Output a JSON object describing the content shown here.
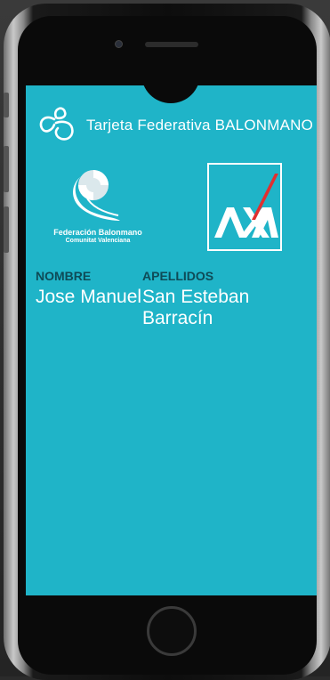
{
  "app": {
    "title": "Tarjeta Federativa BALONMANO",
    "logo_icon": "handball-swirl-icon"
  },
  "logos": {
    "federation": {
      "line1": "Federación Balonmano",
      "line2": "Comunitat Valenciana",
      "icon": "handball-ball-icon"
    },
    "sponsor": {
      "text": "AXA",
      "icon": "axa-logo-icon"
    }
  },
  "card": {
    "first_name_label": "NOMBRE",
    "first_name_value": "Jose Manuel",
    "last_name_label": "APELLIDOS",
    "last_name_value": "San Esteban Barracín"
  },
  "colors": {
    "screen_bg": "#1fb4c8",
    "label_color": "#0e4b57",
    "axa_red": "#e03030"
  }
}
